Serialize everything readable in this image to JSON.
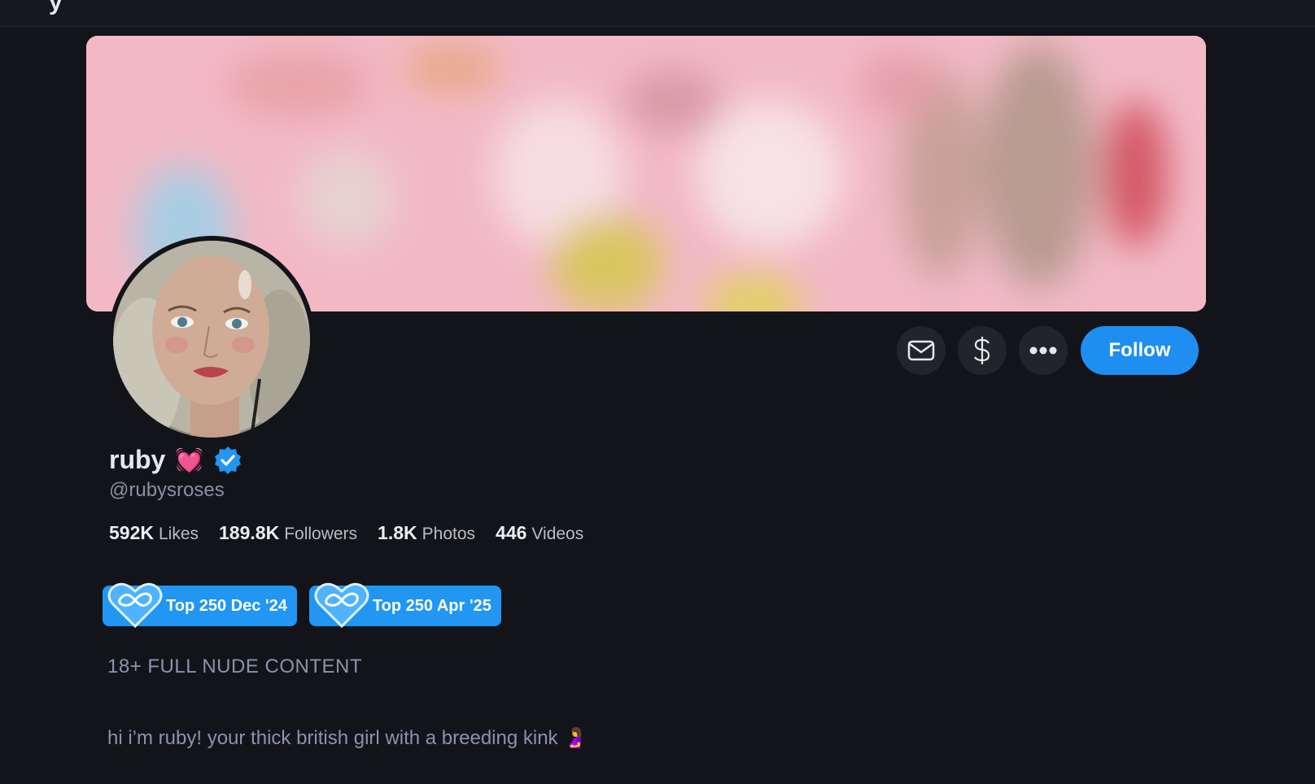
{
  "topbar": {
    "logo_fragment": "y"
  },
  "profile": {
    "display_name": "ruby",
    "name_emoji": "💓",
    "handle": "@rubysroses",
    "verified": true
  },
  "actions": {
    "message_icon": "envelope-icon",
    "tip_icon": "dollar-icon",
    "more_icon": "ellipsis-icon",
    "follow_label": "Follow"
  },
  "stats": [
    {
      "value": "592K",
      "label": "Likes"
    },
    {
      "value": "189.8K",
      "label": "Followers"
    },
    {
      "value": "1.8K",
      "label": "Photos"
    },
    {
      "value": "446",
      "label": "Videos"
    }
  ],
  "badges": [
    {
      "label": "Top 250 Dec '24",
      "icon": "heart-infinity-icon"
    },
    {
      "label": "Top 250 Apr '25",
      "icon": "heart-infinity-icon"
    }
  ],
  "bio": {
    "line1": "18+ FULL NUDE CONTENT",
    "line2": "hi i’m ruby! your thick british girl with a breeding kink 🤰"
  },
  "colors": {
    "background": "#13141a",
    "accent": "#1f8ef1",
    "badge": "#2196f3",
    "banner_pink": "#f2b9c5"
  }
}
